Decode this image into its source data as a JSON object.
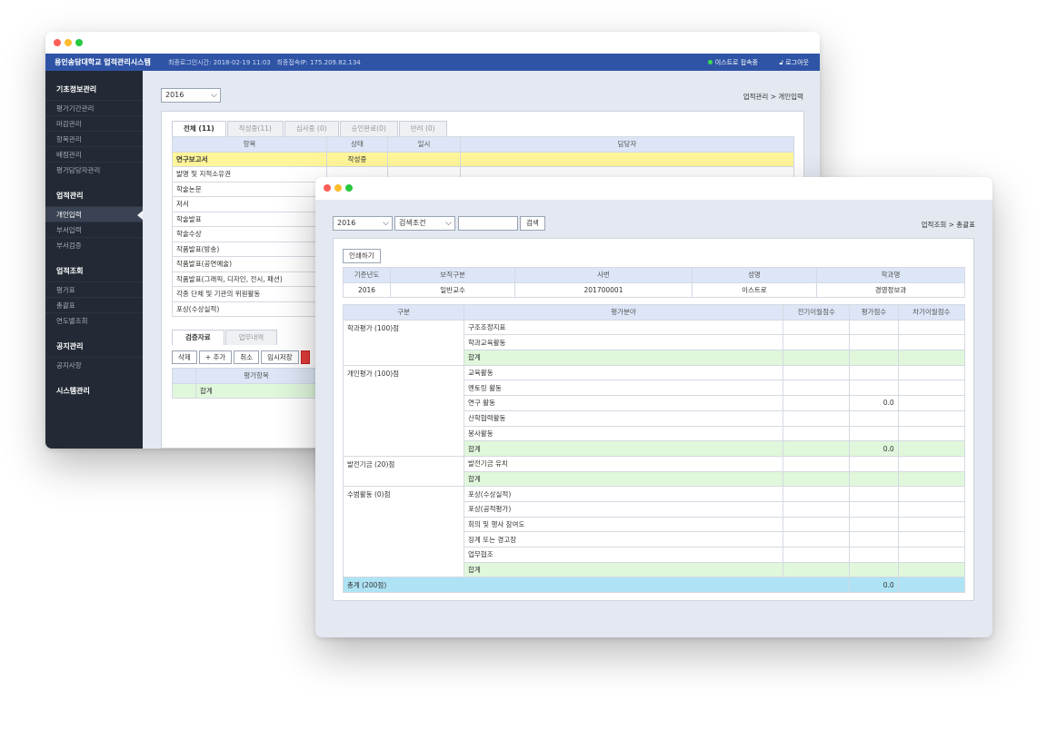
{
  "win1": {
    "app_title": "용인송담대학교 업적관리시스템",
    "last_login": "최종로그인시간: 2018-02-19 11:03",
    "last_ip": "최종접속IP: 175.209.82.134",
    "user": "이스트로 접속중",
    "logout": "로그아웃",
    "sidebar": [
      {
        "head": "기초정보관리",
        "items": [
          "평가기간관리",
          "마감관리",
          "항목관리",
          "배점관리",
          "평가담당자관리"
        ]
      },
      {
        "head": "업적관리",
        "items": [
          "개인입력",
          "부서입력",
          "부서검증"
        ]
      },
      {
        "head": "업적조회",
        "items": [
          "평가표",
          "총괄표",
          "연도별조회"
        ]
      },
      {
        "head": "공지관리",
        "items": [
          "공지사항"
        ]
      },
      {
        "head": "시스템관리",
        "items": []
      }
    ],
    "year": "2016",
    "breadcrumb": "업적관리 > 개인입력",
    "tabs": [
      "전체 (11)",
      "작성중(11)",
      "심사중 (0)",
      "승인완료(0)",
      "반려 (0)"
    ],
    "headers": [
      "항목",
      "상태",
      "일시",
      "담당자"
    ],
    "rows": [
      {
        "item": "연구보고서",
        "status": "작성중"
      },
      {
        "item": "발명 및 지적소유권",
        "status": ""
      },
      {
        "item": "학술논문",
        "status": ""
      },
      {
        "item": "저서",
        "status": ""
      },
      {
        "item": "학술발표",
        "status": ""
      },
      {
        "item": "학술수상",
        "status": ""
      },
      {
        "item": "작품발표(방송)",
        "status": ""
      },
      {
        "item": "작품발표(공연예술)",
        "status": ""
      },
      {
        "item": "작품발표(그래픽, 디자인, 전시, 패션)",
        "status": ""
      },
      {
        "item": "각종 단체 및 기관의 위원활동",
        "status": ""
      },
      {
        "item": "포상(수상실적)",
        "status": ""
      }
    ],
    "sub_tabs": [
      "검증자료",
      "업무내역"
    ],
    "buttons": [
      "삭제",
      "+ 추가",
      "취소",
      "임시저장"
    ],
    "sub_header": "평가항목",
    "sub_total": "합계"
  },
  "win2": {
    "year": "2016",
    "search_cond": "검색조건",
    "search_btn": "검색",
    "breadcrumb": "업적조회 > 총괄표",
    "print_btn": "인쇄하기",
    "info_headers": [
      "기준년도",
      "보직구분",
      "사번",
      "성명",
      "학과명"
    ],
    "info_values": [
      "2016",
      "일반교수",
      "201700001",
      "이스트로",
      "경영정보과"
    ],
    "table_headers": [
      "구분",
      "평가분야",
      "전기이월점수",
      "평가점수",
      "차기이월점수"
    ],
    "groups": [
      {
        "name": "학과평가 (100)점",
        "rows": [
          {
            "field": "구조조정지표",
            "score": ""
          },
          {
            "field": "학과교육활동",
            "score": ""
          },
          {
            "field": "합계",
            "score": "",
            "sum": true
          }
        ]
      },
      {
        "name": "개인평가 (100)점",
        "rows": [
          {
            "field": "교육활동",
            "score": ""
          },
          {
            "field": "멘토링 활동",
            "score": ""
          },
          {
            "field": "연구 활동",
            "score": "0.0"
          },
          {
            "field": "산학협력활동",
            "score": ""
          },
          {
            "field": "봉사활동",
            "score": ""
          },
          {
            "field": "합계",
            "score": "0.0",
            "sum": true
          }
        ]
      },
      {
        "name": "발전기금 (20)점",
        "rows": [
          {
            "field": "발전기금 유치",
            "score": ""
          },
          {
            "field": "합계",
            "score": "",
            "sum": true
          }
        ]
      },
      {
        "name": "수범활동 (0)점",
        "rows": [
          {
            "field": "포상(수상실적)",
            "score": ""
          },
          {
            "field": "포상(공적평가)",
            "score": ""
          },
          {
            "field": "회의 및 행사 참여도",
            "score": ""
          },
          {
            "field": "징계 또는 경고장",
            "score": ""
          },
          {
            "field": "업무협조",
            "score": ""
          },
          {
            "field": "합계",
            "score": "",
            "sum": true
          }
        ]
      }
    ],
    "total_label": "총계 (200점)",
    "total_value": "0.0"
  },
  "colors": {
    "appbar": "#2f54a6",
    "sidebar": "#232a36",
    "yellow_row": "#fff69a",
    "green_row": "#e0f7dc",
    "total_row": "#aee3f5"
  }
}
